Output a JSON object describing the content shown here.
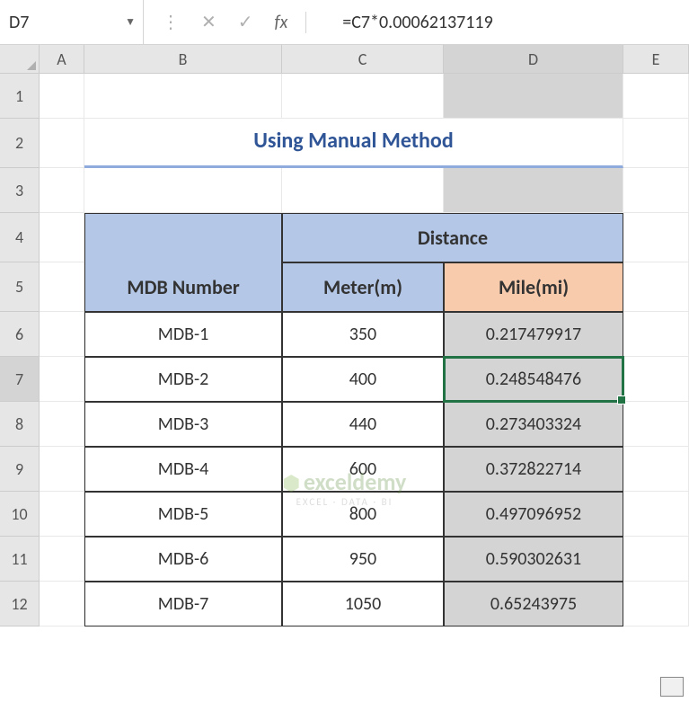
{
  "formula_bar": {
    "cell_ref": "D7",
    "formula": "=C7*0.00062137119",
    "fx_label": "fx"
  },
  "columns": [
    "A",
    "B",
    "C",
    "D",
    "E"
  ],
  "rows": [
    "1",
    "2",
    "3",
    "4",
    "5",
    "6",
    "7",
    "8",
    "9",
    "10",
    "11",
    "12"
  ],
  "title": "Using Manual Method",
  "headers": {
    "mdb": "MDB Number",
    "distance": "Distance",
    "meter": "Meter(m)",
    "mile": "Mile(mi)"
  },
  "table": [
    {
      "mdb": "MDB-1",
      "meter": "350",
      "mile": "0.217479917"
    },
    {
      "mdb": "MDB-2",
      "meter": "400",
      "mile": "0.248548476"
    },
    {
      "mdb": "MDB-3",
      "meter": "440",
      "mile": "0.273403324"
    },
    {
      "mdb": "MDB-4",
      "meter": "600",
      "mile": "0.372822714"
    },
    {
      "mdb": "MDB-5",
      "meter": "800",
      "mile": "0.497096952"
    },
    {
      "mdb": "MDB-6",
      "meter": "950",
      "mile": "0.590302631"
    },
    {
      "mdb": "MDB-7",
      "meter": "1050",
      "mile": "0.65243975"
    }
  ],
  "watermark": {
    "brand": "exceldemy",
    "tagline": "EXCEL · DATA · BI"
  },
  "chart_data": {
    "type": "table",
    "title": "Using Manual Method",
    "columns": [
      "MDB Number",
      "Meter(m)",
      "Mile(mi)"
    ],
    "rows": [
      [
        "MDB-1",
        350,
        0.217479917
      ],
      [
        "MDB-2",
        400,
        0.248548476
      ],
      [
        "MDB-3",
        440,
        0.273403324
      ],
      [
        "MDB-4",
        600,
        0.372822714
      ],
      [
        "MDB-5",
        800,
        0.497096952
      ],
      [
        "MDB-6",
        950,
        0.590302631
      ],
      [
        "MDB-7",
        1050,
        0.65243975
      ]
    ],
    "formula": "=C7*0.00062137119",
    "active_cell": "D7"
  }
}
